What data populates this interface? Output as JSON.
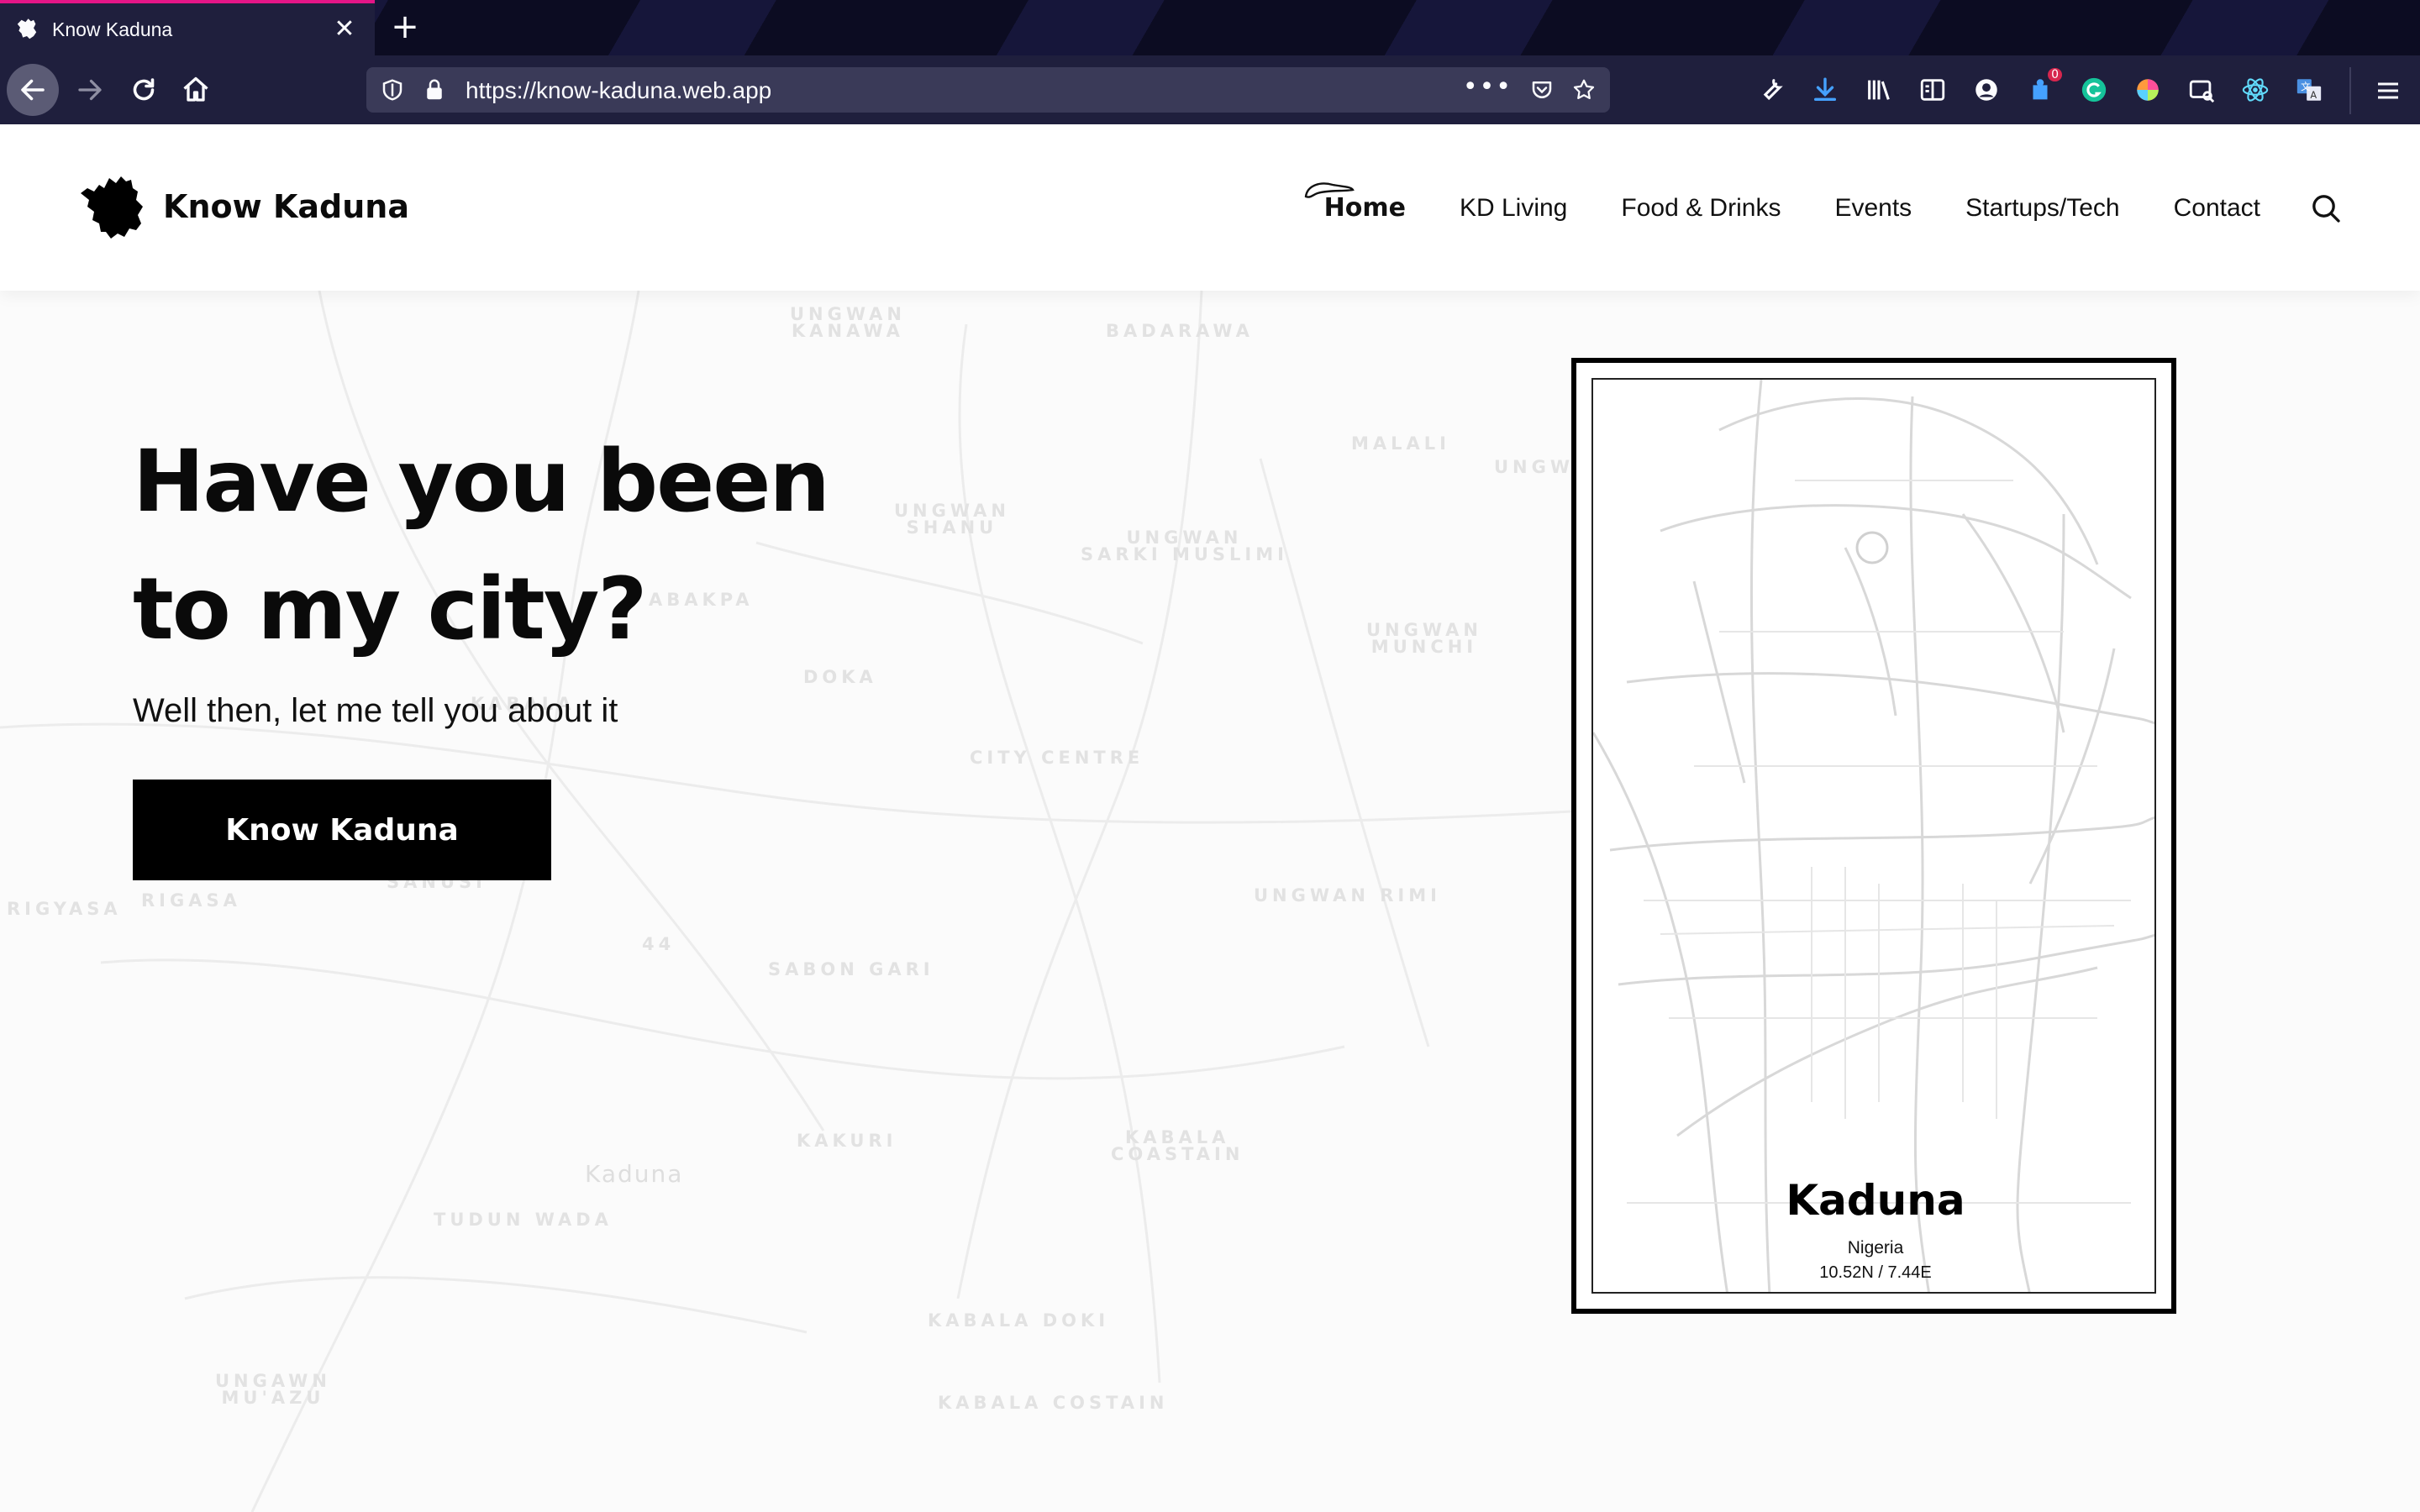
{
  "browser": {
    "tab": {
      "title": "Know Kaduna",
      "close_glyph": "✕"
    },
    "new_tab_glyph": "+",
    "url": "https://know-kaduna.web.app",
    "url_more": "•••",
    "toolbar_icons": [
      "wrench-icon",
      "download-icon",
      "library-icon",
      "reader-view-icon",
      "account-icon",
      "extension-badge-icon",
      "grammarly-icon",
      "color-picker-icon",
      "screenshot-icon",
      "react-devtools-icon",
      "translate-icon"
    ],
    "extension_badge": "0"
  },
  "site": {
    "logo_text": "Know Kaduna",
    "nav": [
      {
        "label": "Home",
        "active": true
      },
      {
        "label": "KD Living"
      },
      {
        "label": "Food & Drinks"
      },
      {
        "label": "Events"
      },
      {
        "label": "Startups/Tech"
      },
      {
        "label": "Contact"
      }
    ]
  },
  "hero": {
    "title_line1": "Have you been",
    "title_line2": "to my city?",
    "subtitle": "Well then, let me tell you about it",
    "cta": "Know Kaduna"
  },
  "map_labels": {
    "ungwan_kanawa": "UNGWAN\nKANAWA",
    "badarawa": "BADARAWA",
    "malali": "MALALI",
    "ungwa": "UNGWA",
    "ungwan_shanu": "UNGWAN\nSHANU",
    "ungwan_sarki": "UNGWAN\nSARKI MUSLIMI",
    "abakpa": "ABAKPA",
    "ungwan_munchi": "UNGWAN\nMUNCHI",
    "doka": "DOKA",
    "kabala": "KABALA",
    "city_centre": "CITY CENTRE",
    "rigyasa": "RIGYASA",
    "rigasa": "RIGASA",
    "sanusi": "SANUSI",
    "ungwan_rimi": "UNGWAN RIMI",
    "sabon_gari": "SABON GARI",
    "n44": "44",
    "kakuri": "KAKURI",
    "kabala_coastain": "KABALA\nCOASTAIN",
    "kaduna": "Kaduna",
    "tudun_wada": "TUDUN WADA",
    "kabala_doki": "KABALA DOKI",
    "ungawn_mu_azu": "UNGAWN\nMU'AZU",
    "kabala_costain": "KABALA COSTAIN"
  },
  "poster": {
    "city": "Kaduna",
    "country": "Nigeria",
    "coords": "10.52N / 7.44E"
  },
  "colors": {
    "chrome_bg": "#1f1f3d",
    "tab_accent": "#e31587",
    "page_bg": "#fbfbfb",
    "cta_bg": "#000000"
  }
}
